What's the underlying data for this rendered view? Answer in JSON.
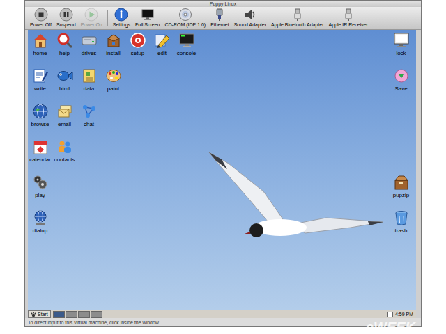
{
  "window": {
    "title": "Puppy Linux"
  },
  "toolbar": {
    "items": [
      {
        "label": "Power Off",
        "disabled": false
      },
      {
        "label": "Suspend",
        "disabled": false
      },
      {
        "label": "Power On",
        "disabled": true
      },
      {
        "label": "Settings",
        "disabled": false
      },
      {
        "label": "Full Screen",
        "disabled": false
      },
      {
        "label": "CD-ROM (IDE 1:0)",
        "disabled": false
      },
      {
        "label": "Ethernet",
        "disabled": false
      },
      {
        "label": "Sound Adapter",
        "disabled": false
      },
      {
        "label": "Apple Bluetooth Adapter",
        "disabled": false
      },
      {
        "label": "Apple IR Receiver",
        "disabled": false
      }
    ]
  },
  "desktop": {
    "left_rows": [
      {
        "icons": [
          {
            "label": "home"
          },
          {
            "label": "help"
          },
          {
            "label": "drives"
          },
          {
            "label": "install"
          },
          {
            "label": "setup"
          },
          {
            "label": "edit"
          },
          {
            "label": "console"
          }
        ]
      },
      {
        "icons": [
          {
            "label": "write"
          },
          {
            "label": "html"
          },
          {
            "label": "data"
          },
          {
            "label": "paint"
          }
        ]
      },
      {
        "icons": [
          {
            "label": "browse"
          },
          {
            "label": "email"
          },
          {
            "label": "chat"
          }
        ]
      },
      {
        "icons": [
          {
            "label": "calendar"
          },
          {
            "label": "contacts"
          }
        ]
      },
      {
        "icons": [
          {
            "label": "play"
          }
        ]
      },
      {
        "icons": [
          {
            "label": "dialup"
          }
        ]
      }
    ],
    "right_top": [
      {
        "label": "lock"
      },
      {
        "label": "Save"
      }
    ],
    "right_bottom": [
      {
        "label": "pupzip"
      },
      {
        "label": "trash"
      }
    ]
  },
  "taskbar": {
    "start": "Start",
    "workspaces": [
      {
        "selected": true
      },
      {
        "selected": false
      },
      {
        "selected": false
      },
      {
        "selected": false
      }
    ],
    "clock": "4:59 PM"
  },
  "status_bar": "To direct input to this virtual machine, click inside the window.",
  "watermark": "eWEEK"
}
